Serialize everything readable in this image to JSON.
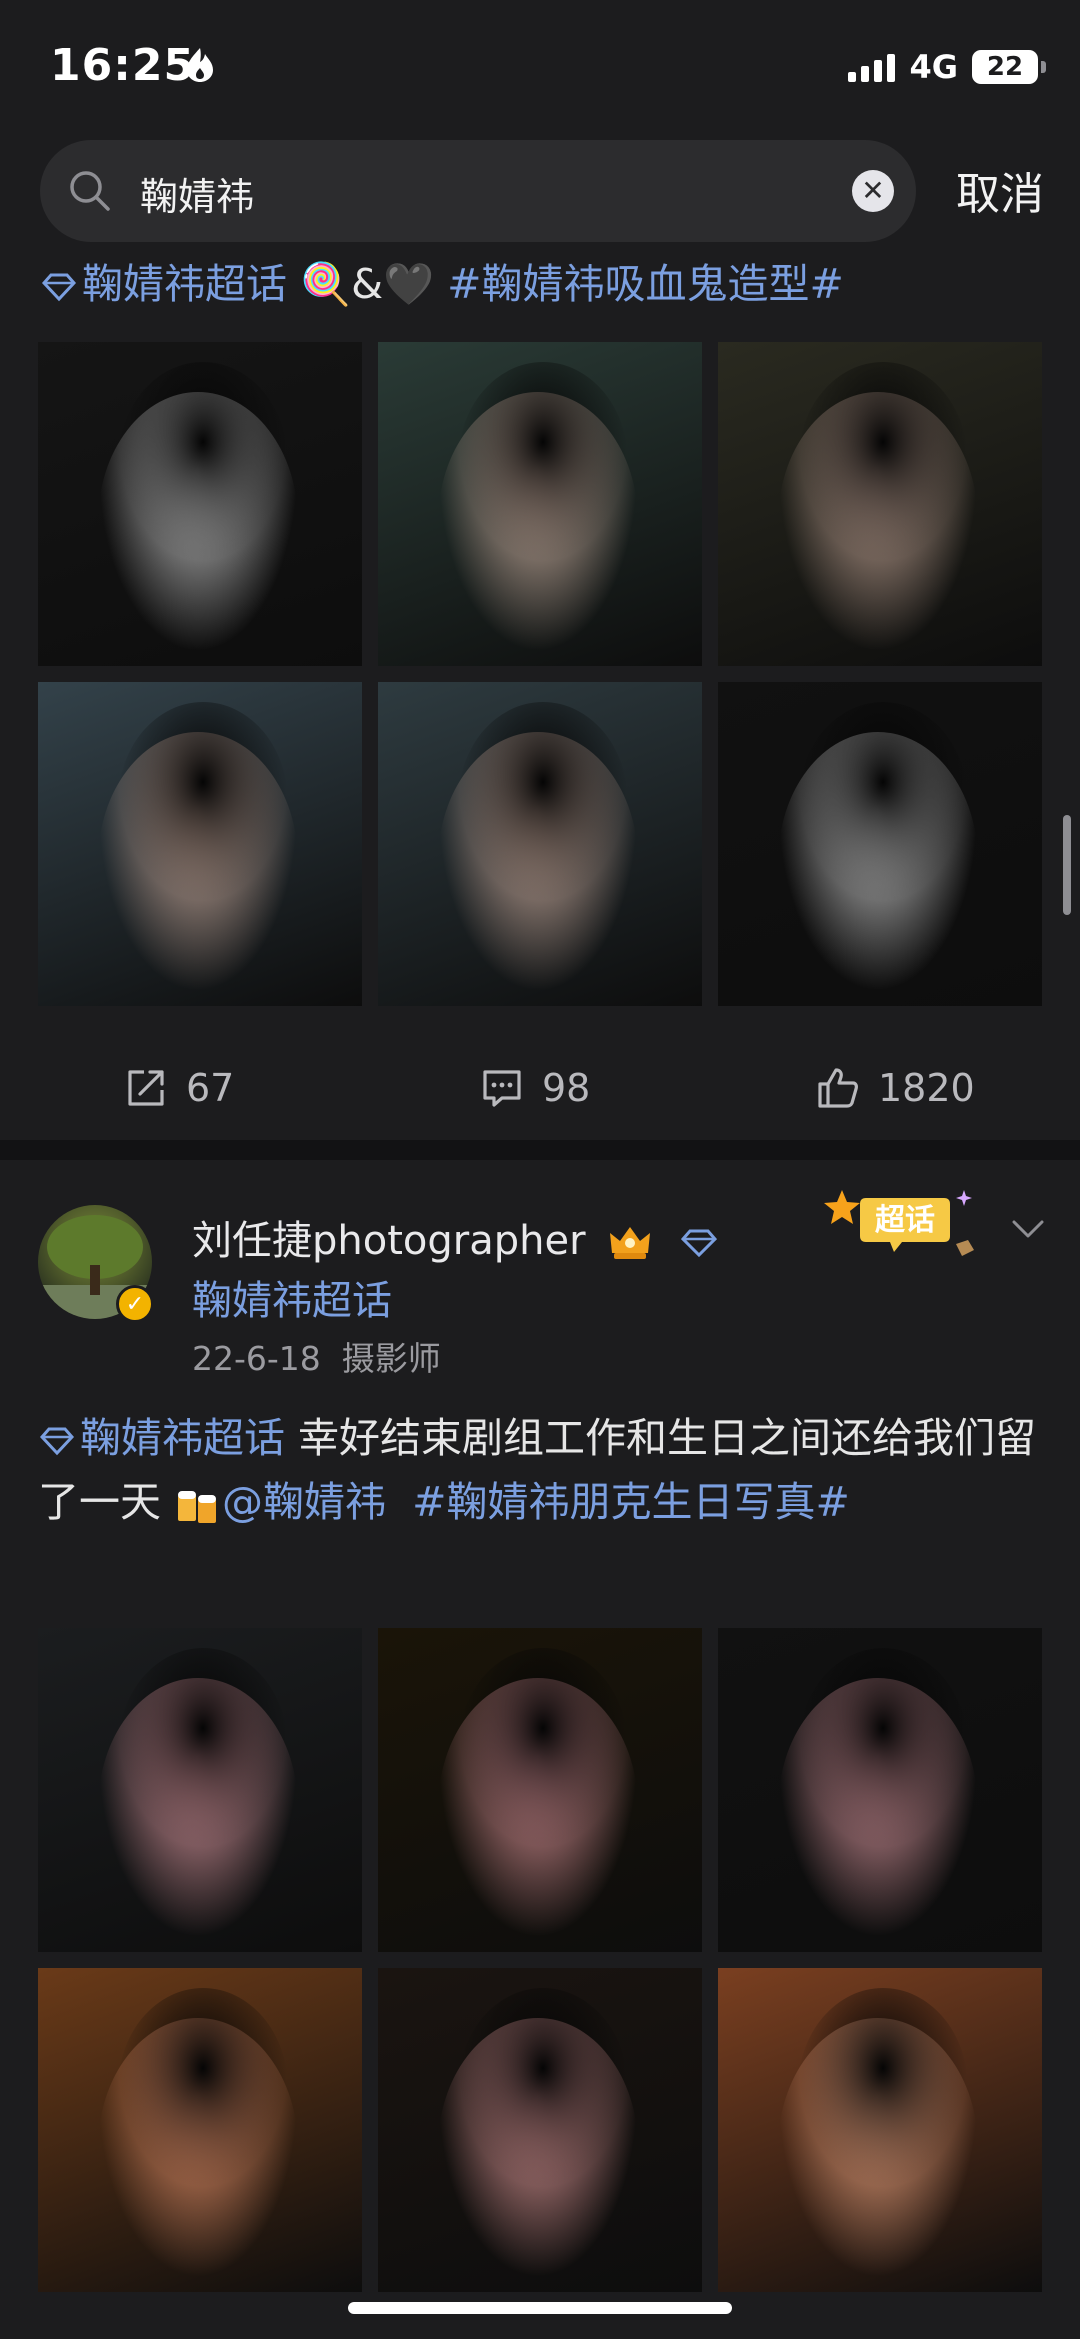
{
  "status_bar": {
    "time": "16:25",
    "network": "4G",
    "battery": "22"
  },
  "search": {
    "query": "鞠婧祎",
    "cancel_label": "取消"
  },
  "post1": {
    "topic": "鞠婧祎超话",
    "emoji_text": "🍭&🖤",
    "hashtag": "#鞠婧祎吸血鬼造型#",
    "images": [
      {
        "alt": "photo-1",
        "bg": "#151515",
        "fig": "#cfcfcf"
      },
      {
        "alt": "photo-2",
        "bg": "#2a3b36",
        "fig": "#d7b8a8"
      },
      {
        "alt": "photo-3",
        "bg": "#2a2a20",
        "fig": "#c8a99a"
      },
      {
        "alt": "photo-4",
        "bg": "#33424a",
        "fig": "#d2b0a0"
      },
      {
        "alt": "photo-5",
        "bg": "#2e3b40",
        "fig": "#d6b4a4"
      },
      {
        "alt": "photo-6",
        "bg": "#111111",
        "fig": "#d0d0d0"
      }
    ],
    "stats": {
      "reposts": "67",
      "comments": "98",
      "likes": "1820"
    }
  },
  "post2": {
    "username": "刘任捷photographer",
    "user_topic": "鞠婧祎超话",
    "date": "22-6-18",
    "role": "摄影师",
    "badge_label": "超话",
    "text_topic": "鞠婧祎超话",
    "text_body_1": " 幸好结束剧组工作和生日之间还给我们留了一天",
    "mention": "@鞠婧祎",
    "hashtag": "#鞠婧祎朋克生日写真#",
    "images": [
      {
        "alt": "photo-1",
        "bg": "#1b1d1f",
        "fig": "#e8a0a8"
      },
      {
        "alt": "photo-2",
        "bg": "#1a1408",
        "fig": "#e69aa0"
      },
      {
        "alt": "photo-3",
        "bg": "#111111",
        "fig": "#e49ea6"
      },
      {
        "alt": "photo-4",
        "bg": "#6a3a18",
        "fig": "#e8946e"
      },
      {
        "alt": "photo-5",
        "bg": "#1a1410",
        "fig": "#e9a0a0"
      },
      {
        "alt": "photo-6",
        "bg": "#7a3f20",
        "fig": "#f0a884"
      }
    ]
  }
}
